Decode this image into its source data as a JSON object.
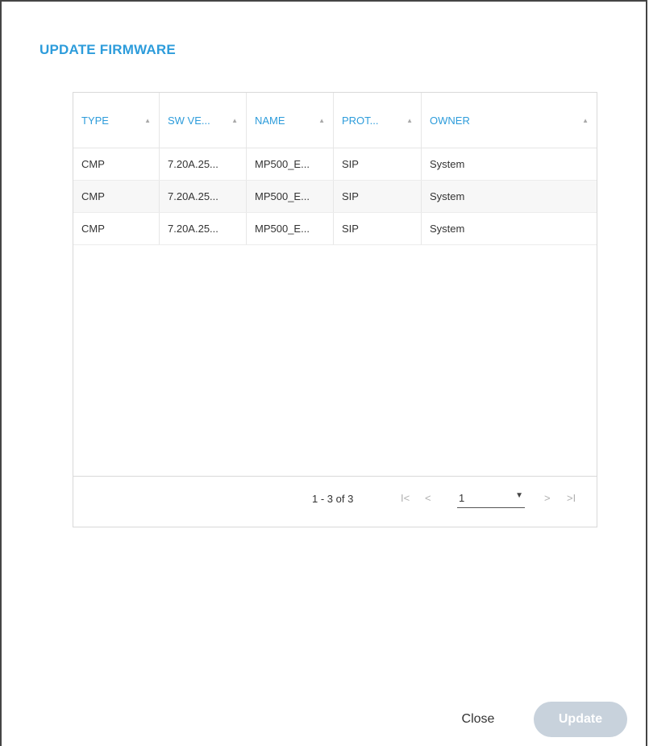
{
  "dialog": {
    "title": "UPDATE FIRMWARE"
  },
  "table": {
    "columns": [
      {
        "label": "TYPE"
      },
      {
        "label": "SW VE..."
      },
      {
        "label": "NAME"
      },
      {
        "label": "PROT..."
      },
      {
        "label": "OWNER"
      }
    ],
    "rows": [
      [
        "CMP",
        "7.20A.25...",
        "MP500_E...",
        "SIP",
        "System"
      ],
      [
        "CMP",
        "7.20A.25...",
        "MP500_E...",
        "SIP",
        "System"
      ],
      [
        "CMP",
        "7.20A.25...",
        "MP500_E...",
        "SIP",
        "System"
      ]
    ]
  },
  "pager": {
    "range": "1 - 3 of 3",
    "first": "I<",
    "prev": "<",
    "page": "1",
    "next": ">",
    "last": ">I"
  },
  "actions": {
    "close": "Close",
    "update": "Update"
  },
  "colors": {
    "accent": "#2d9cdb",
    "disabled_button": "#c8d2dc"
  }
}
